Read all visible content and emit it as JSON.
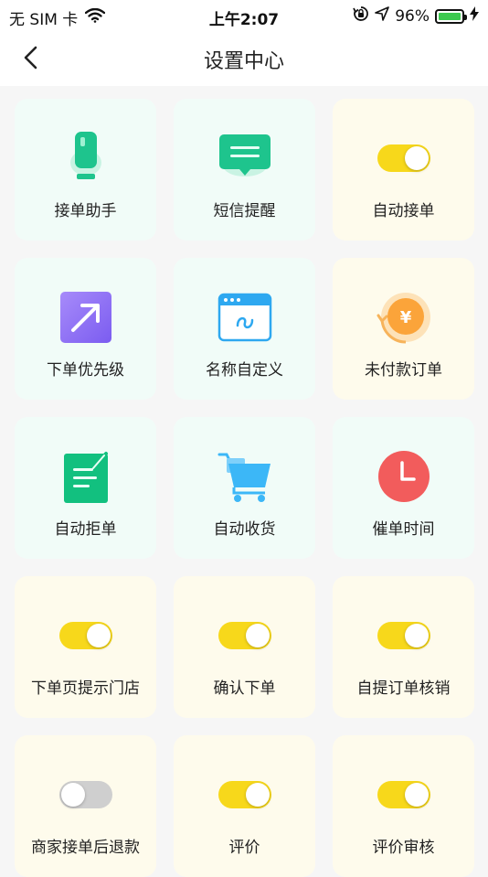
{
  "status_bar": {
    "carrier": "无 SIM 卡",
    "time": "上午2:07",
    "battery": "96%"
  },
  "nav": {
    "title": "设置中心"
  },
  "colors": {
    "toggle_on": "#f7d81b",
    "toggle_off": "#cfcfcf",
    "green": "#1ec48d",
    "card_mint": "#f1fcf8",
    "card_cream": "#fefbec"
  },
  "items": [
    {
      "label": "接单助手",
      "icon": "microphone-icon"
    },
    {
      "label": "短信提醒",
      "icon": "message-icon"
    },
    {
      "label": "自动接单",
      "toggle": true
    },
    {
      "label": "下单优先级",
      "icon": "arrow-up-right-icon"
    },
    {
      "label": "名称自定义",
      "icon": "browser-window-icon"
    },
    {
      "label": "未付款订单",
      "icon": "yuan-coin-icon"
    },
    {
      "label": "自动拒单",
      "icon": "edit-document-icon"
    },
    {
      "label": "自动收货",
      "icon": "shopping-cart-icon"
    },
    {
      "label": "催单时间",
      "icon": "clock-icon"
    },
    {
      "label": "下单页提示门店",
      "toggle": true
    },
    {
      "label": "确认下单",
      "toggle": true
    },
    {
      "label": "自提订单核销",
      "toggle": true
    },
    {
      "label": "商家接单后退款",
      "toggle": false
    },
    {
      "label": "评价",
      "toggle": true
    },
    {
      "label": "评价审核",
      "toggle": true
    }
  ]
}
